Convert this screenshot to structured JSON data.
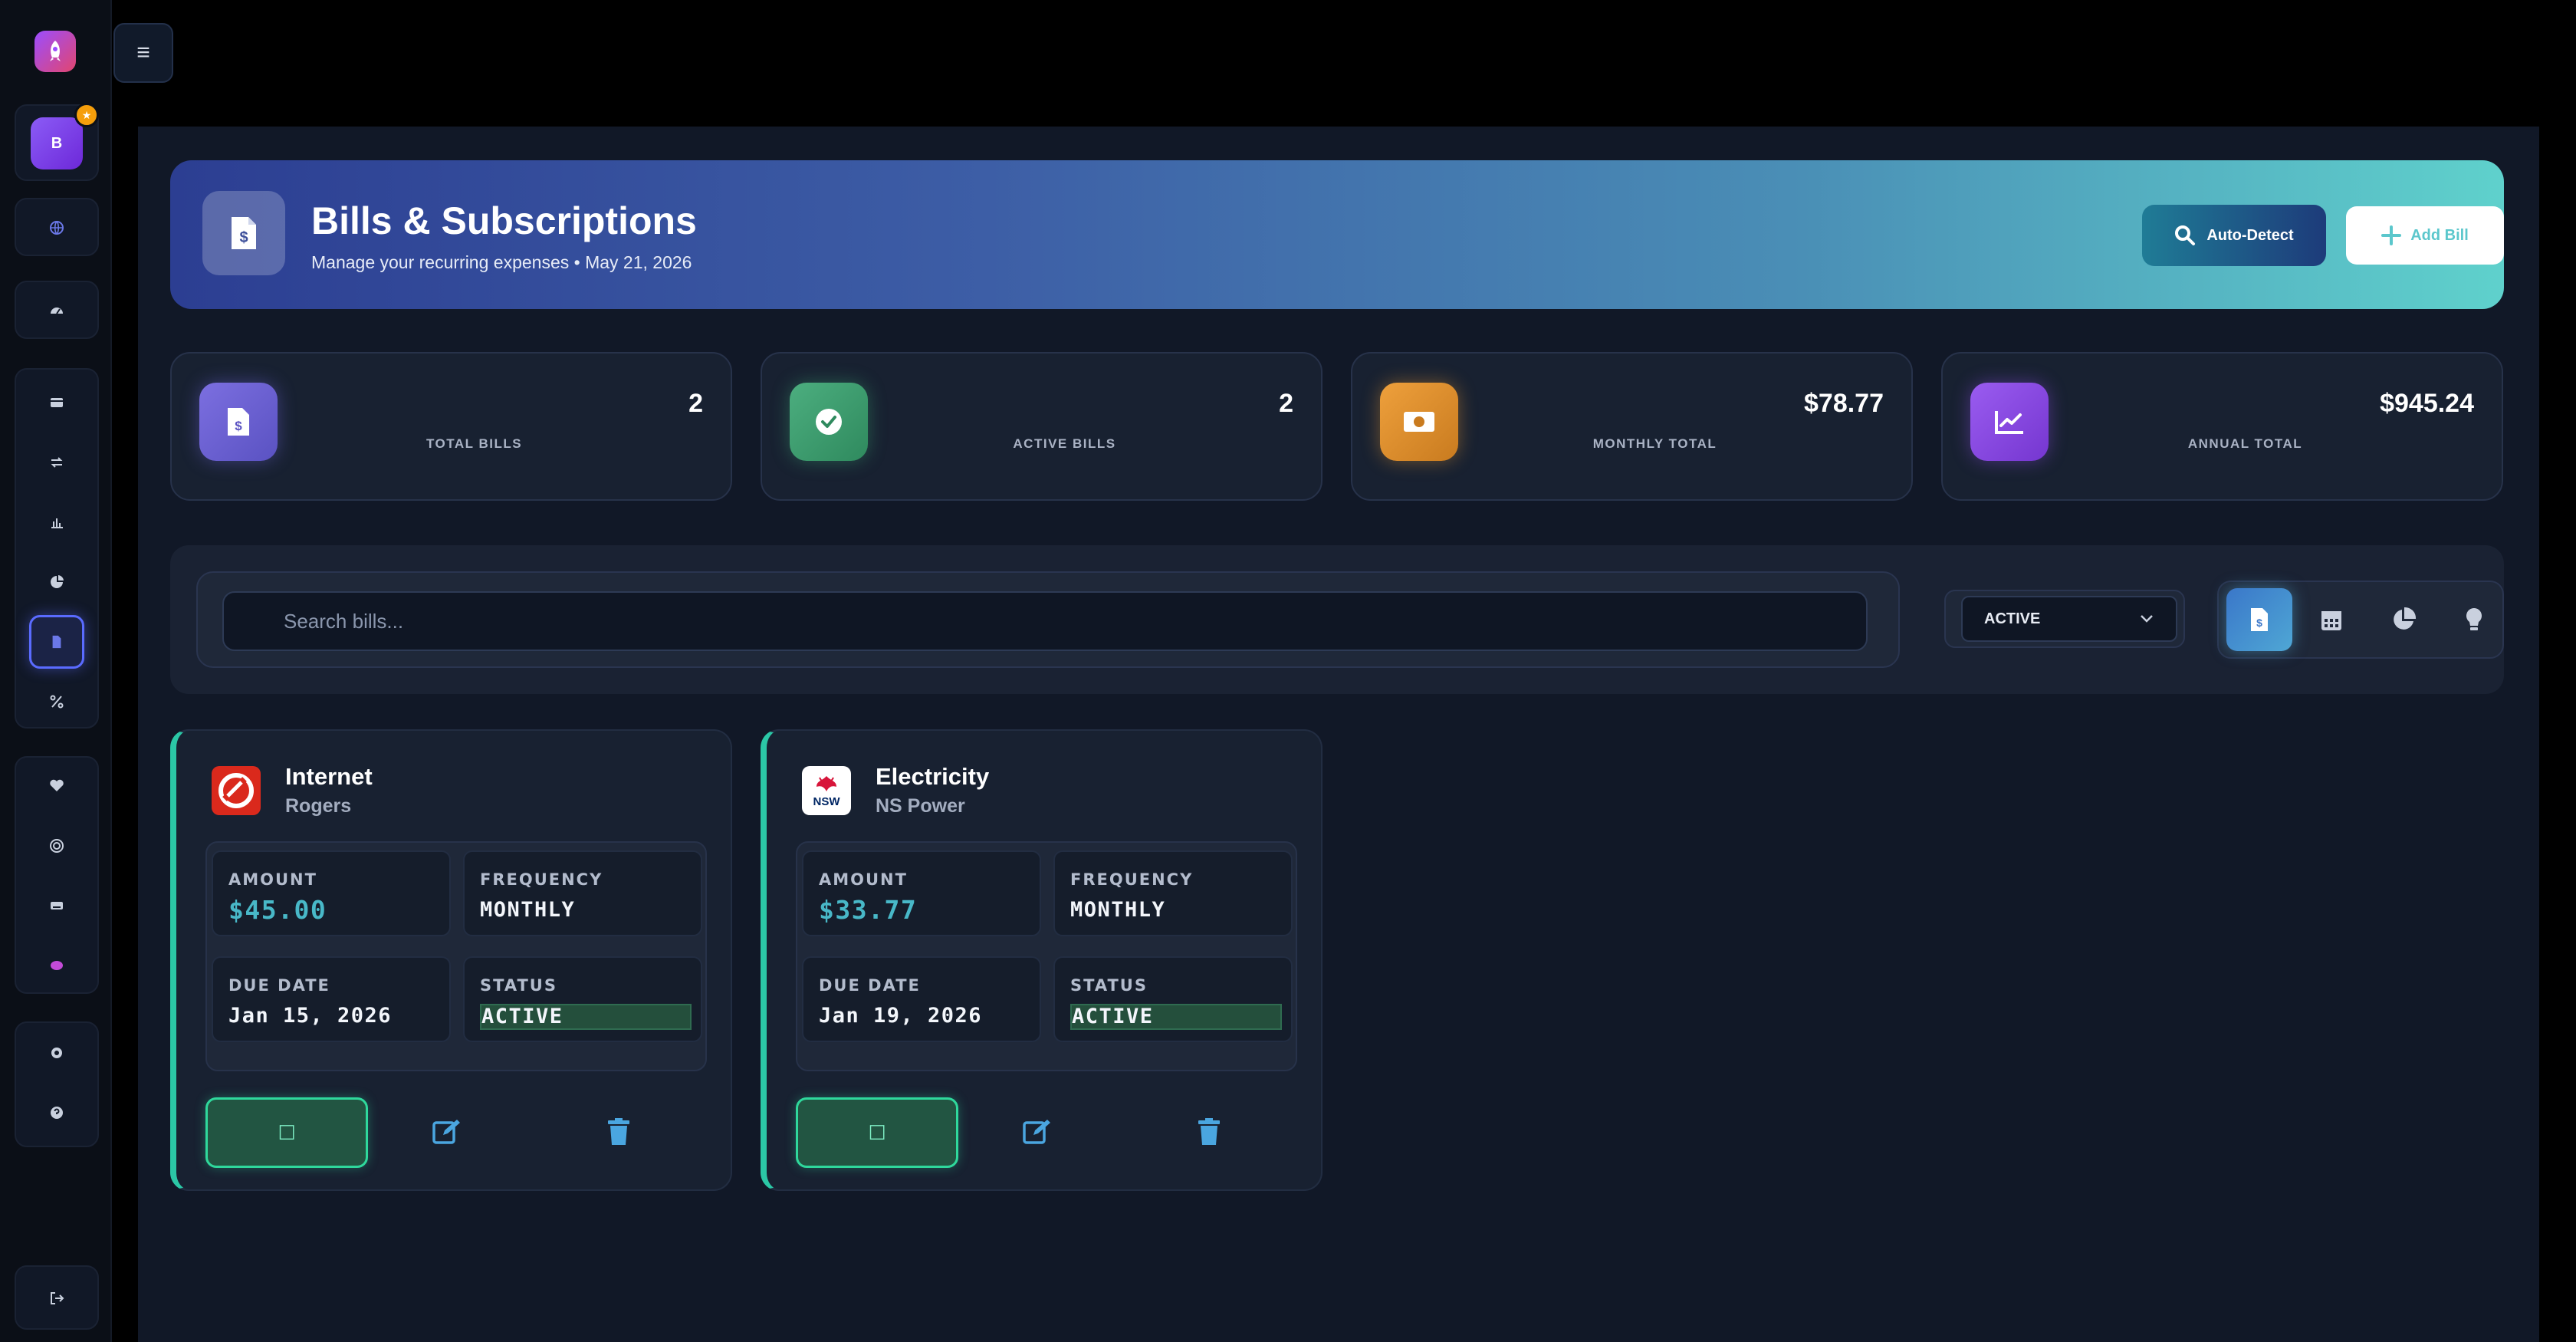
{
  "header": {
    "title": "Bills & Subscriptions",
    "subtitle": "Manage your recurring expenses • May 21, 2026",
    "auto_detect_label": "Auto-Detect",
    "add_bill_label": "Add Bill"
  },
  "sidebar": {
    "avatar_initial": "B",
    "avatar_badge": "★"
  },
  "stats": [
    {
      "label": "TOTAL BILLS",
      "value": "2",
      "icon": "file-invoice-icon",
      "color": "#6c63d8"
    },
    {
      "label": "ACTIVE BILLS",
      "value": "2",
      "icon": "check-circle-icon",
      "color": "#3a9d6f"
    },
    {
      "label": "MONTHLY TOTAL",
      "value": "$78.77",
      "icon": "money-bill-icon",
      "color": "#e0922c"
    },
    {
      "label": "ANNUAL TOTAL",
      "value": "$945.24",
      "icon": "chart-line-icon",
      "color": "#8a4be0"
    }
  ],
  "filters": {
    "search_placeholder": "Search bills...",
    "status_selected": "ACTIVE"
  },
  "labels": {
    "amount": "AMOUNT",
    "frequency": "FREQUENCY",
    "due_date": "DUE DATE",
    "status": "STATUS"
  },
  "bills": [
    {
      "name": "Internet",
      "provider": "Rogers",
      "amount": "$45.00",
      "frequency": "MONTHLY",
      "due_date": "Jan 15, 2026",
      "status": "ACTIVE",
      "pay_glyph": "☐"
    },
    {
      "name": "Electricity",
      "provider": "NS Power",
      "amount": "$33.77",
      "frequency": "MONTHLY",
      "due_date": "Jan 19, 2026",
      "status": "ACTIVE",
      "pay_glyph": "☐",
      "logo_text": "NSW"
    }
  ],
  "colors": {
    "accent": "#5bc7cc",
    "status_active": "#244f3c",
    "amount": "#48b8c8"
  }
}
